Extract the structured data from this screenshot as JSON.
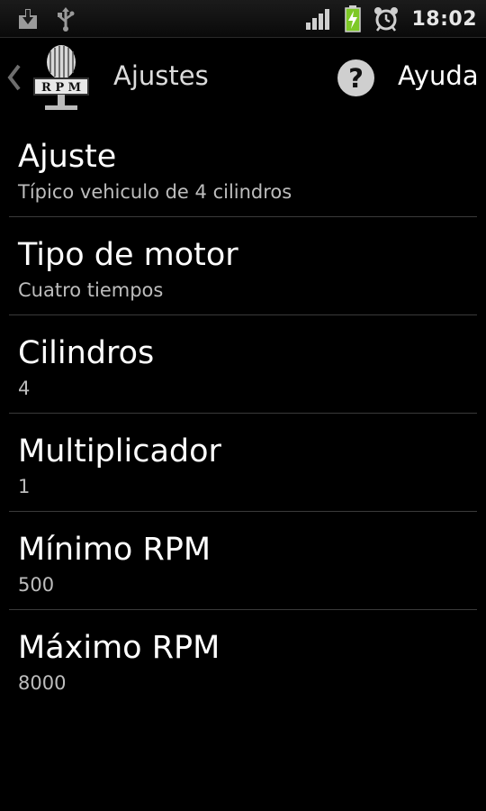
{
  "status_bar": {
    "time": "18:02",
    "icons": [
      "download-icon",
      "usb-icon",
      "signal-icon",
      "battery-charging-icon",
      "alarm-icon"
    ]
  },
  "action_bar": {
    "title": "Ajustes",
    "help_label": "Ayuda",
    "help_icon": "?",
    "logo_text": "RPM"
  },
  "settings": [
    {
      "title": "Ajuste",
      "summary": "Típico vehiculo de 4 cilindros"
    },
    {
      "title": "Tipo de motor",
      "summary": "Cuatro tiempos"
    },
    {
      "title": "Cilindros",
      "summary": "4"
    },
    {
      "title": "Multiplicador",
      "summary": "1"
    },
    {
      "title": "Mínimo RPM",
      "summary": "500"
    },
    {
      "title": "Máximo RPM",
      "summary": "8000"
    }
  ],
  "colors": {
    "background": "#000000",
    "battery_accent": "#7ec927",
    "summary_text": "#bdbdbd",
    "divider": "#3a3a3a"
  }
}
